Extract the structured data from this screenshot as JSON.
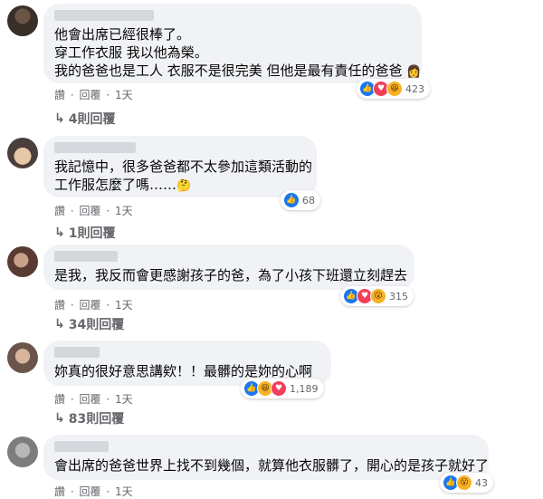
{
  "actions": {
    "like": "讚",
    "dot": "·",
    "reply": "回覆",
    "time": "1天"
  },
  "comments": [
    {
      "lines": [
        "他會出席已經很棒了。",
        "穿工作衣服 我以他為榮。",
        "我的爸爸也是工人 衣服不是很完美 但他是最有責任的爸爸"
      ],
      "emoji": "👩",
      "reactions": [
        "like",
        "love",
        "haha"
      ],
      "count": "423",
      "replies": "4則回覆"
    },
    {
      "lines": [
        "我記憶中，很多爸爸都不太參加這類活動的",
        "工作服怎麼了嗎……"
      ],
      "emoji": "🤔",
      "reactions": [
        "like"
      ],
      "count": "68",
      "replies": "1則回覆"
    },
    {
      "lines": [
        "是我，我反而會更感謝孩子的爸，為了小孩下班還立刻趕去"
      ],
      "reactions": [
        "like",
        "love",
        "wow"
      ],
      "count": "315",
      "replies": "34則回覆"
    },
    {
      "lines": [
        "妳真的很好意思講欸！！最髒的是妳的心啊"
      ],
      "reactions": [
        "like",
        "haha",
        "love"
      ],
      "count": "1,189",
      "replies": "83則回覆"
    },
    {
      "lines": [
        "會出席的爸爸世界上找不到幾個，就算他衣服髒了，開心的是孩子就好了"
      ],
      "reactions": [
        "like",
        "wow"
      ],
      "count": "43",
      "replies": ""
    }
  ]
}
